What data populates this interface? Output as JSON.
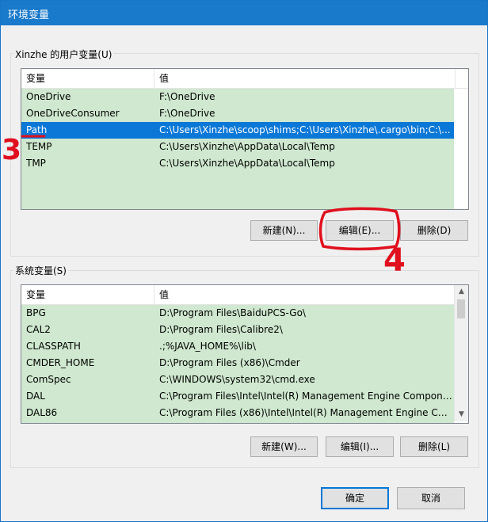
{
  "window": {
    "title": "环境变量"
  },
  "user_vars": {
    "group_label": "Xinzhe 的用户变量(U)",
    "columns": [
      "变量",
      "值"
    ],
    "rows": [
      {
        "name": "OneDrive",
        "value": "F:\\OneDrive"
      },
      {
        "name": "OneDriveConsumer",
        "value": "F:\\OneDrive"
      },
      {
        "name": "Path",
        "value": "C:\\Users\\Xinzhe\\scoop\\shims;C:\\Users\\Xinzhe\\.cargo\\bin;C:\\..."
      },
      {
        "name": "TEMP",
        "value": "C:\\Users\\Xinzhe\\AppData\\Local\\Temp"
      },
      {
        "name": "TMP",
        "value": "C:\\Users\\Xinzhe\\AppData\\Local\\Temp"
      }
    ],
    "selected_row": "Path",
    "buttons": {
      "new": "新建(N)...",
      "edit": "编辑(E)...",
      "delete": "删除(D)"
    }
  },
  "system_vars": {
    "group_label": "系统变量(S)",
    "columns": [
      "变量",
      "值"
    ],
    "rows": [
      {
        "name": "BPG",
        "value": "D:\\Program Files\\BaiduPCS-Go\\"
      },
      {
        "name": "CAL2",
        "value": "D:\\Program Files\\Calibre2\\"
      },
      {
        "name": "CLASSPATH",
        "value": ".;%JAVA_HOME%\\lib\\"
      },
      {
        "name": "CMDER_HOME",
        "value": "D:\\Program Files (x86)\\Cmder"
      },
      {
        "name": "ComSpec",
        "value": "C:\\WINDOWS\\system32\\cmd.exe"
      },
      {
        "name": "DAL",
        "value": "C:\\Program Files\\Intel\\Intel(R) Management Engine Compone..."
      },
      {
        "name": "DAL86",
        "value": "C:\\Program Files (x86)\\Intel\\Intel(R) Management Engine Co..."
      }
    ],
    "buttons": {
      "new": "新建(W)...",
      "edit": "编辑(I)...",
      "delete": "删除(L)"
    }
  },
  "dialog_buttons": {
    "ok": "确定",
    "cancel": "取消"
  },
  "annotations": {
    "step3": "3",
    "step4": "4",
    "color": "#e0101e"
  },
  "colors": {
    "titlebar": "#1979ca",
    "row_highlight": "#cfe8cf",
    "selection": "#0b78d7"
  }
}
